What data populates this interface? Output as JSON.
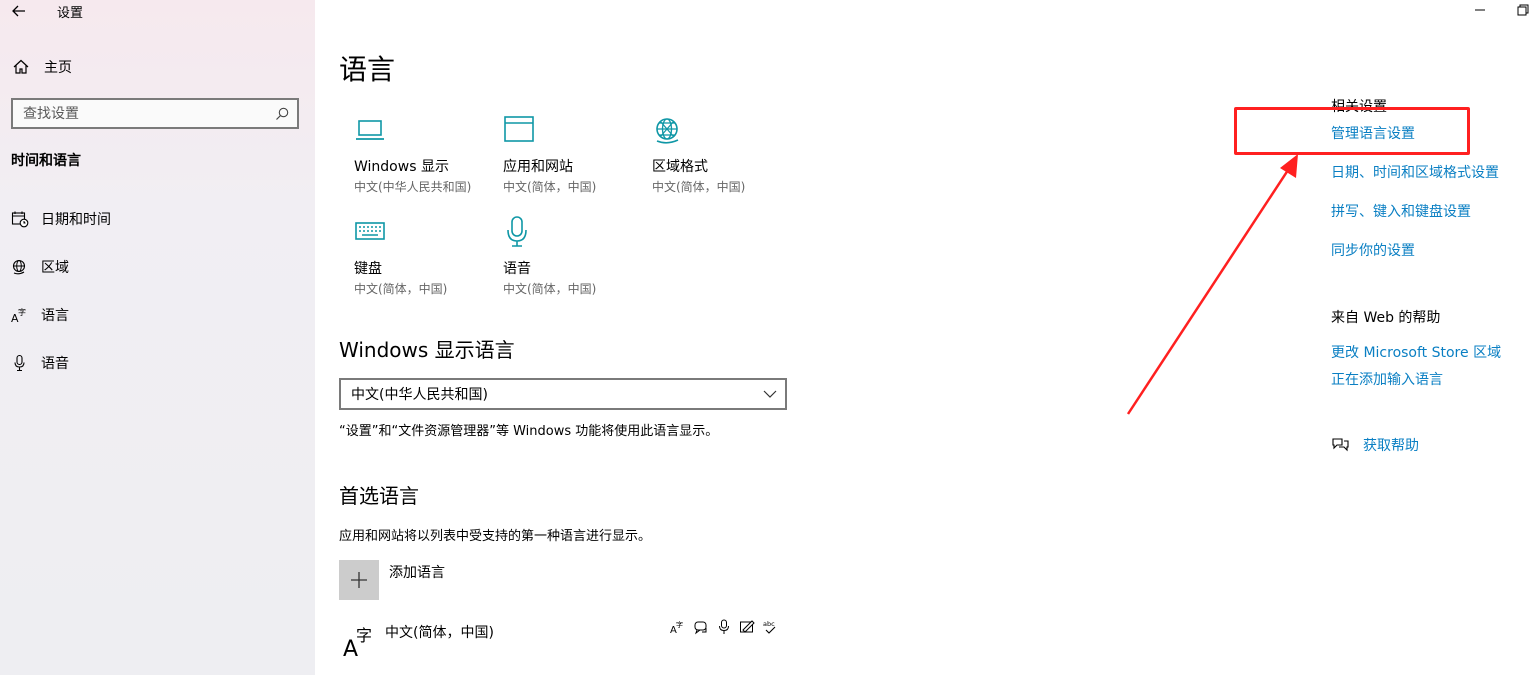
{
  "window": {
    "title": "设置"
  },
  "sidebar": {
    "home_label": "主页",
    "search_placeholder": "查找设置",
    "section_title": "时间和语言",
    "items": [
      {
        "label": "日期和时间",
        "icon": "calendar-clock-icon"
      },
      {
        "label": "区域",
        "icon": "globe-region-icon"
      },
      {
        "label": "语言",
        "icon": "language-icon"
      },
      {
        "label": "语音",
        "icon": "microphone-icon"
      }
    ]
  },
  "main": {
    "title": "语言",
    "tiles": [
      {
        "title": "Windows 显示",
        "subtitle": "中文(中华人民共和国)",
        "icon": "laptop-icon"
      },
      {
        "title": "应用和网站",
        "subtitle": "中文(简体，中国)",
        "icon": "browser-window-icon"
      },
      {
        "title": "区域格式",
        "subtitle": "中文(简体，中国)",
        "icon": "globe-format-icon"
      },
      {
        "title": "键盘",
        "subtitle": "中文(简体，中国)",
        "icon": "keyboard-icon"
      },
      {
        "title": "语音",
        "subtitle": "中文(简体，中国)",
        "icon": "microphone-icon"
      }
    ],
    "display_language": {
      "heading": "Windows 显示语言",
      "selected": "中文(中华人民共和国)",
      "description": "“设置”和“文件资源管理器”等 Windows 功能将使用此语言显示。"
    },
    "preferred": {
      "heading": "首选语言",
      "description": "应用和网站将以列表中受支持的第一种语言进行显示。",
      "add_label": "添加语言",
      "languages": [
        {
          "name": "中文(简体，中国)",
          "features": [
            "display-language-icon",
            "text-to-speech-icon",
            "speech-recognition-icon",
            "handwriting-icon",
            "spellcheck-icon"
          ]
        }
      ]
    }
  },
  "related": {
    "heading": "相关设置",
    "links": [
      "管理语言设置",
      "日期、时间和区域格式设置",
      "拼写、键入和键盘设置",
      "同步你的设置"
    ],
    "web_help_heading": "来自 Web 的帮助",
    "web_links": [
      "更改 Microsoft Store 区域",
      "正在添加输入语言"
    ],
    "get_help": "获取帮助"
  },
  "colors": {
    "accent": "#0a7fc3",
    "icon_teal": "#0f97a6",
    "annotation_red": "#ff2020"
  }
}
